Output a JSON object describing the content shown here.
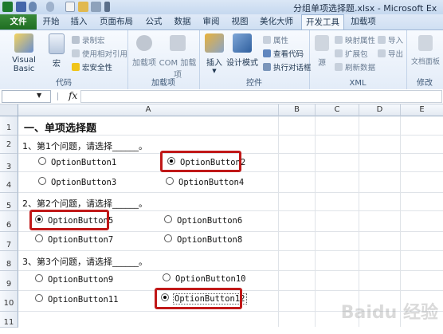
{
  "window": {
    "title": "分组单项选择题.xlsx - Microsoft Ex"
  },
  "tabs": [
    "文件",
    "开始",
    "插入",
    "页面布局",
    "公式",
    "数据",
    "审阅",
    "视图",
    "美化大师",
    "开发工具",
    "加载项"
  ],
  "ribbon": {
    "groups": {
      "code": "代码",
      "addins": "加载项",
      "controls": "控件",
      "xml": "XML",
      "modify": "修改"
    },
    "visual_basic": "Visual Basic",
    "macros": "宏",
    "record_macro": "录制宏",
    "relative_ref": "使用相对引用",
    "macro_security": "宏安全性",
    "addins_btn": "加载项",
    "com_addins": "COM 加载项",
    "insert": "插入",
    "design_mode": "设计模式",
    "properties": "属性",
    "view_code": "查看代码",
    "run_dialog": "执行对话框",
    "source": "源",
    "map_props": "映射属性",
    "expansion": "扩展包",
    "refresh_data": "刷新数据",
    "import": "导入",
    "export": "导出",
    "doc_panel": "文档面板"
  },
  "formula_bar": {
    "name_box": "",
    "fx": "fx",
    "value": ""
  },
  "columns": [
    "A",
    "B",
    "C",
    "D",
    "E"
  ],
  "rows": [
    "1",
    "2",
    "3",
    "4",
    "5",
    "6",
    "7",
    "8",
    "9",
    "10",
    "11"
  ],
  "sheet": {
    "title": "一、单项选择题",
    "q1": "1、第1个问题，请选择______。",
    "q2": "2、第2个问题，请选择______。",
    "q3": "3、第3个问题，请选择______。"
  },
  "options": [
    {
      "label": "OptionButton1",
      "checked": false
    },
    {
      "label": "OptionButton2",
      "checked": true
    },
    {
      "label": "OptionButton3",
      "checked": false
    },
    {
      "label": "OptionButton4",
      "checked": false
    },
    {
      "label": "OptionButton5",
      "checked": true
    },
    {
      "label": "OptionButton6",
      "checked": false
    },
    {
      "label": "OptionButton7",
      "checked": false
    },
    {
      "label": "OptionButton8",
      "checked": false
    },
    {
      "label": "OptionButton9",
      "checked": false
    },
    {
      "label": "OptionButton10",
      "checked": false
    },
    {
      "label": "OptionButton11",
      "checked": false
    },
    {
      "label": "OptionButton12",
      "checked": true
    }
  ],
  "watermark": "Baidu 经验",
  "colors": {
    "file_tab": "#2a7d2e",
    "highlight": "#c01818",
    "ribbon": "#e3ecf8"
  }
}
